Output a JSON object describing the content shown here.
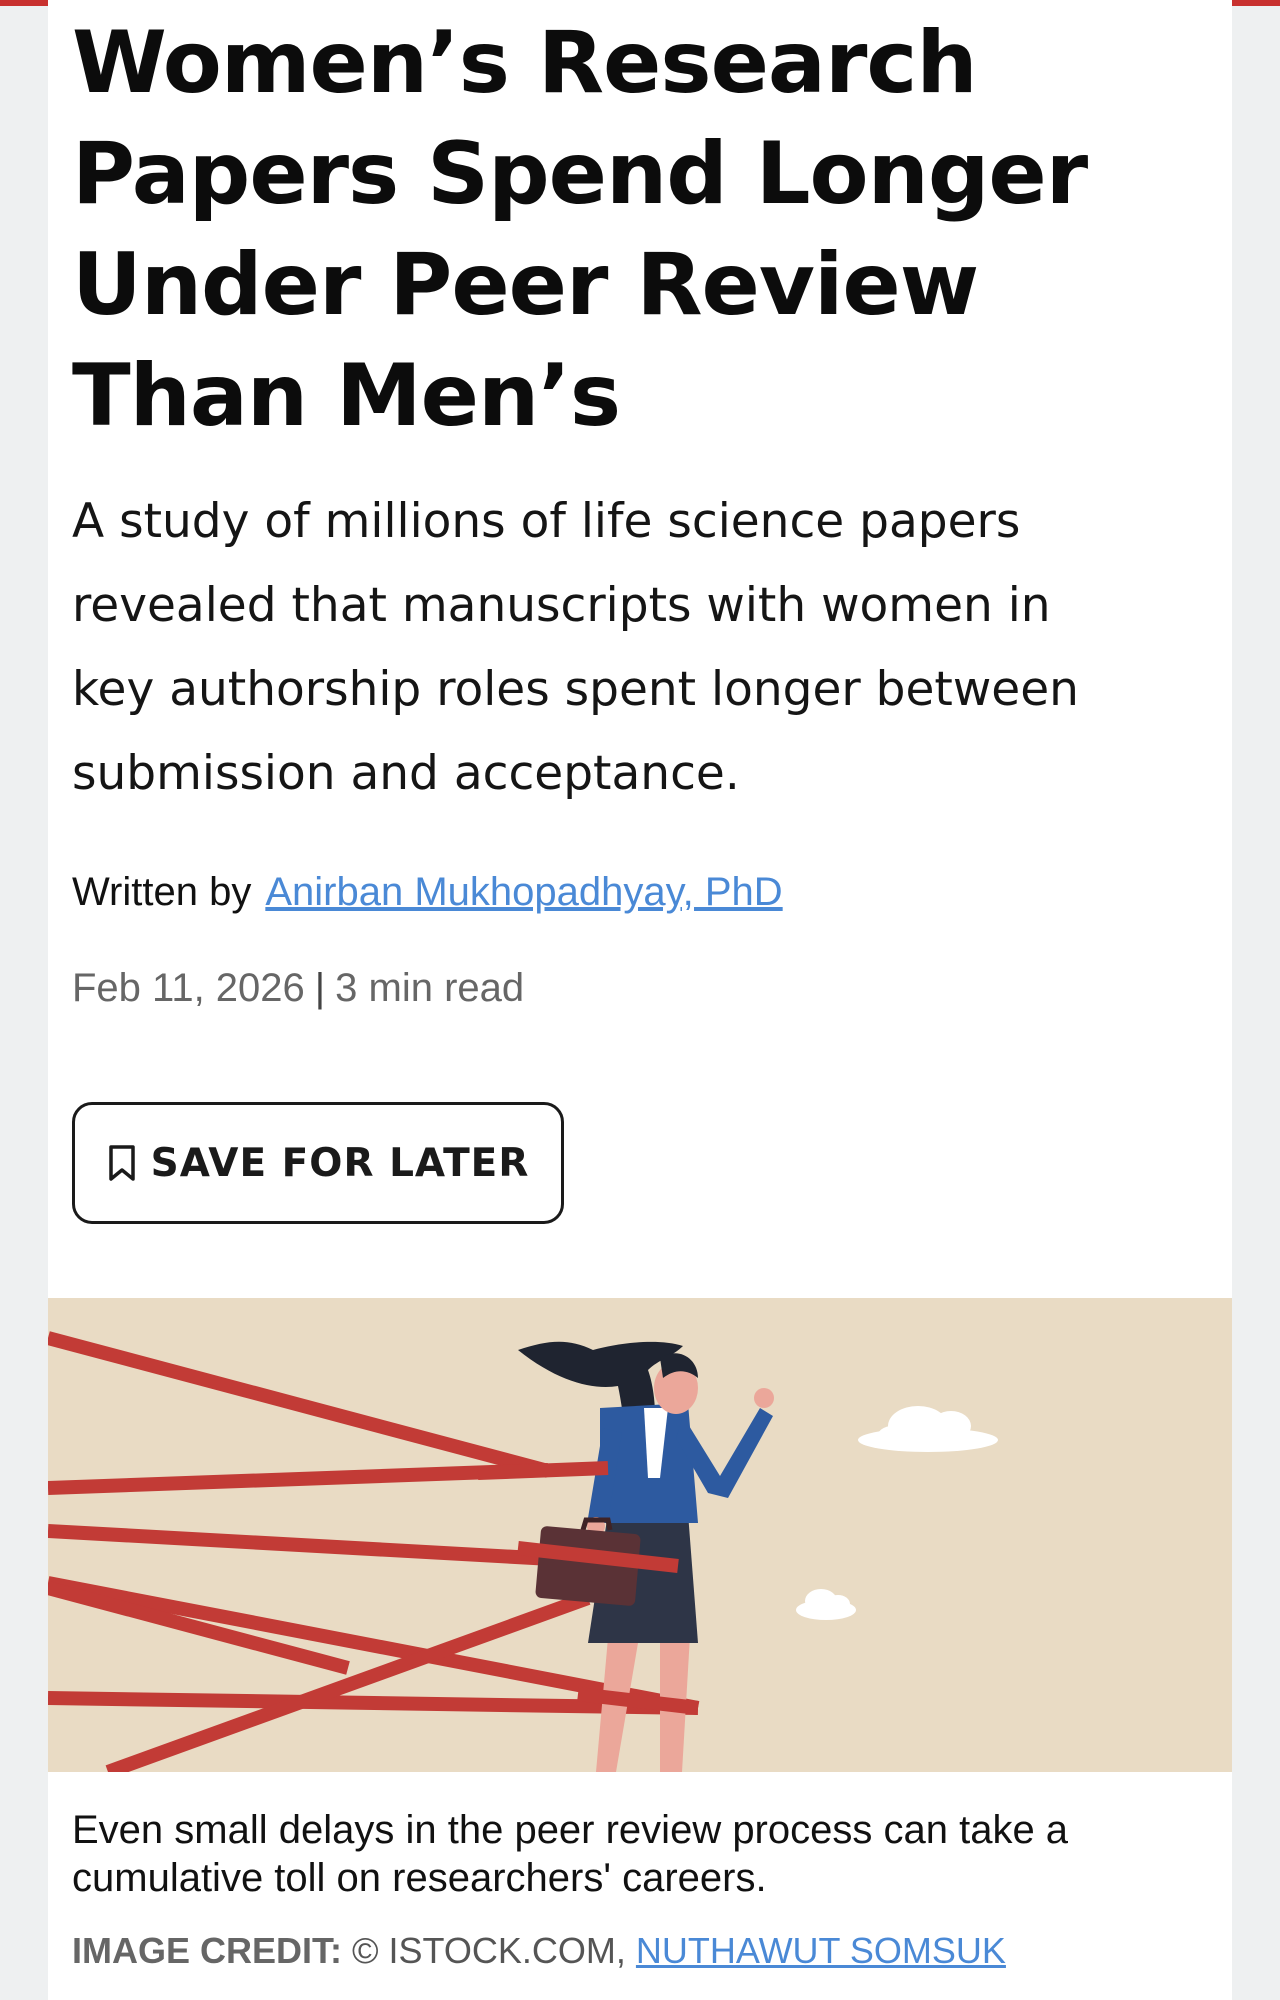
{
  "article": {
    "headline_lines": [
      "Women’s Research",
      "Papers Spend Longer",
      "Under Peer Review",
      "Than Men’s"
    ],
    "dek_lines": [
      "A study of millions of life science papers",
      "revealed that manuscripts with women in",
      "key authorship roles spent longer between",
      "submission and acceptance."
    ],
    "byline_prefix": "Written by",
    "author": "Anirban Mukhopadhyay, PhD",
    "date": "Feb 11, 2026",
    "separator": "|",
    "read_time": "3 min read",
    "save_label": "SAVE FOR LATER",
    "save_icon": "bookmark-icon"
  },
  "image": {
    "description_icon": "woman-entangled-in-red-tape-illustration",
    "caption_lines": [
      "Even small delays in the peer review process can take a",
      "cumulative toll on researchers' careers."
    ],
    "credit_label": "IMAGE CREDIT:",
    "credit_text": "© ISTOCK.COM,",
    "credit_link": "NUTHAWUT SOMSUK"
  },
  "colors": {
    "accent_bar": "#c8312f",
    "link": "#4a89d6",
    "hero_background": "#e9dbc4",
    "tape": "#c23b36"
  }
}
